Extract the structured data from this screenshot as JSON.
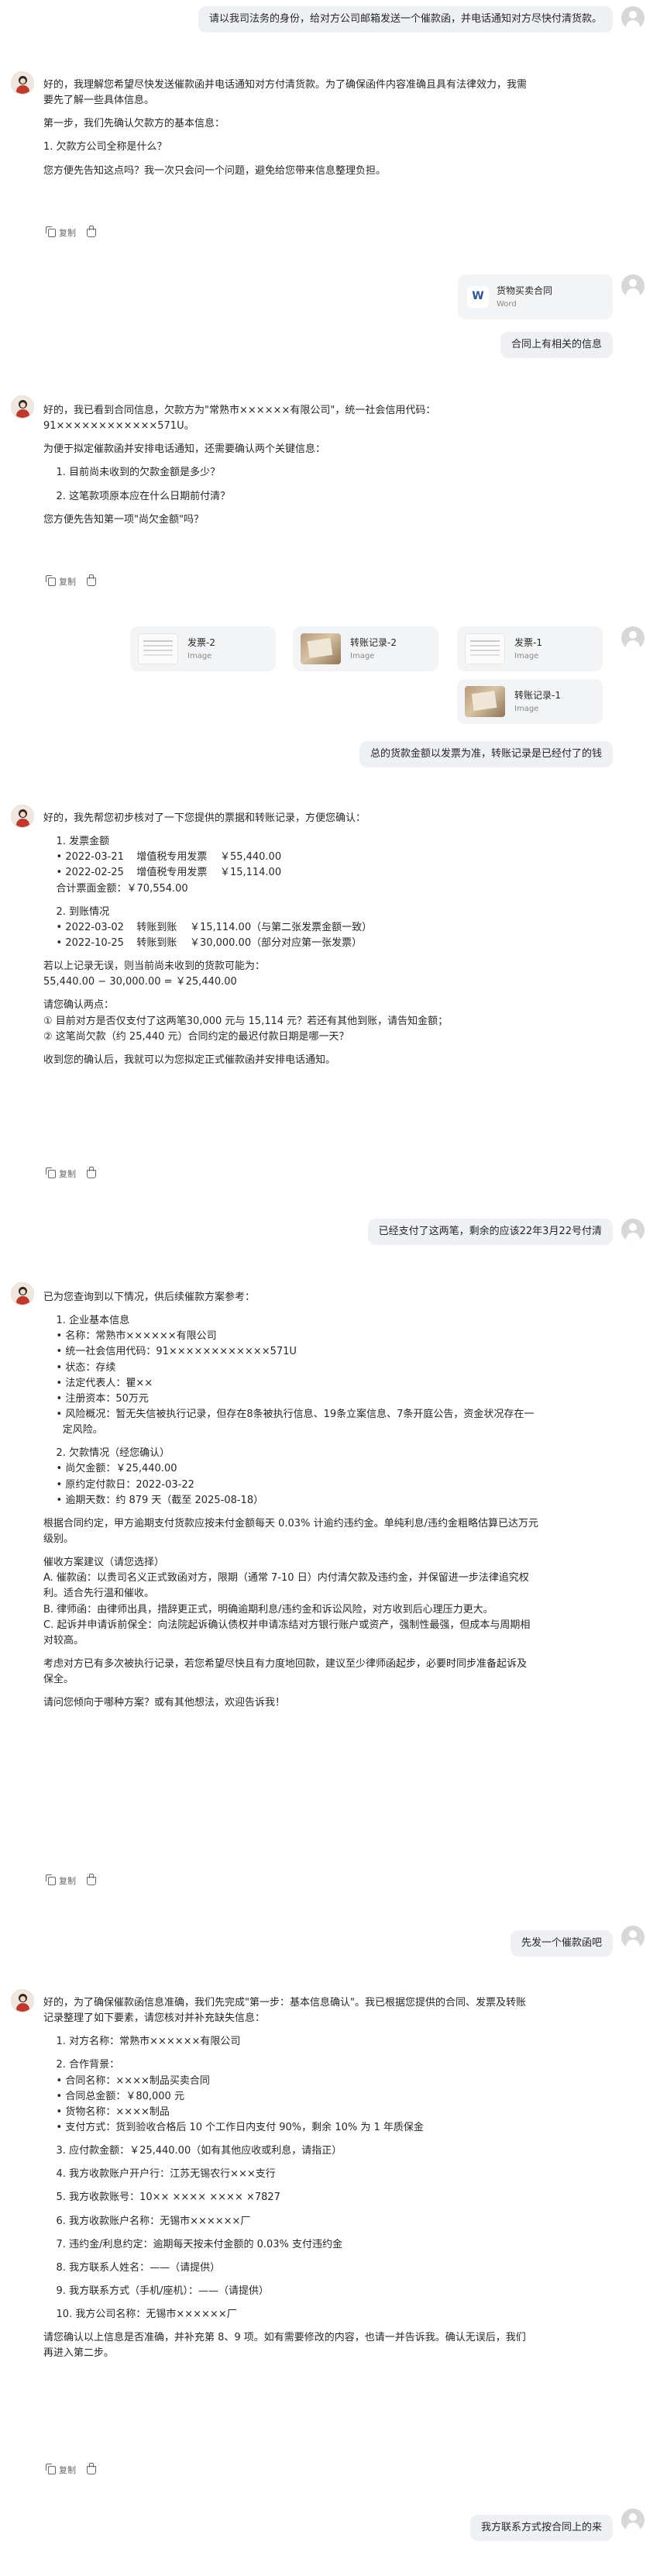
{
  "messages": {
    "u1": "请以我司法务的身份，给对方公司邮箱发送一个催款函，并电话通知对方尽快付清货款。",
    "b1": [
      "好的，我理解您希望尽快发送催款函并电话通知对方付清货款。为了确保函件内容准确且具有法律效力，我需",
      "要先了解一些具体信息。",
      "",
      "第一步，我们先确认欠款方的基本信息：",
      "",
      "1. 欠款方公司全称是什么？",
      "",
      "您方便先告知这点吗？我一次只会问一个问题，避免给您带来信息整理负担。"
    ],
    "u2_file": {
      "title": "货物买卖合同",
      "type": "Word"
    },
    "u2": "合同上有相关的信息",
    "b2": [
      "好的，我已看到合同信息，欠款方为\"常熟市××××××有限公司\"，统一社会信用代码：",
      "91××××××××××××571U。",
      "",
      "为便于拟定催款函并安排电话通知，还需要确认两个关键信息：",
      "",
      "    1. 目前尚未收到的欠款金额是多少？",
      "",
      "    2. 这笔款项原本应在什么日期前付清？",
      "",
      "您方便先告知第一项\"尚欠金额\"吗？"
    ],
    "u3_images": [
      {
        "title": "发票-2",
        "type": "Image"
      },
      {
        "title": "转账记录-2",
        "type": "Image"
      },
      {
        "title": "发票-1",
        "type": "Image"
      },
      {
        "title": "转账记录-1",
        "type": "Image"
      }
    ],
    "u3": "总的货款金额以发票为准，转账记录是已经付了的钱",
    "b3": [
      "好的，我先帮您初步核对了一下您提供的票据和转账记录，方便您确认：",
      "",
      "    1. 发票金额",
      "    • 2022-03-21    增值税专用发票    ￥55,440.00",
      "    • 2022-02-25    增值税专用发票    ￥15,114.00",
      "    合计票面金额：￥70,554.00",
      "",
      "    2. 到账情况",
      "    • 2022-03-02    转账到账    ￥15,114.00（与第二张发票金额一致）",
      "    • 2022-10-25    转账到账    ￥30,000.00（部分对应第一张发票）",
      "",
      "若以上记录无误，则当前尚未收到的货款可能为：",
      "55,440.00 − 30,000.00 = ￥25,440.00",
      "",
      "请您确认两点：",
      "① 目前对方是否仅支付了这两笔30,000 元与 15,114 元？若还有其他到账，请告知金额；",
      "② 这笔尚欠款（约 25,440 元）合同约定的最迟付款日期是哪一天？",
      "",
      "收到您的确认后，我就可以为您拟定正式催款函并安排电话通知。"
    ],
    "u4": "已经支付了这两笔，剩余的应该22年3月22号付清",
    "b4": [
      "已为您查询到以下情况，供后续催款方案参考：",
      "",
      "    1. 企业基本信息",
      "    • 名称：常熟市××××××有限公司",
      "    • 统一社会信用代码：91××××××××××××571U",
      "    • 状态：存续",
      "    • 法定代表人：瞿××",
      "    • 注册资本：50万元",
      "    • 风险概况：暂无失信被执行记录，但存在8条被执行信息、19条立案信息、7条开庭公告，资金状况存在一",
      "      定风险。",
      "",
      "    2. 欠款情况（经您确认）",
      "    • 尚欠金额：￥25,440.00",
      "    • 原约定付款日：2022-03-22",
      "    • 逾期天数：约 879 天（截至 2025-08-18）",
      "",
      "根据合同约定，甲方逾期支付货款应按未付金额每天 0.03% 计逾约违约金。单纯利息/违约金粗略估算已达万元",
      "级别。",
      "",
      "催收方案建议（请您选择）",
      "A. 催款函：以贵司名义正式致函对方，限期（通常 7-10 日）内付清欠款及违约金，并保留进一步法律追究权",
      "利。适合先行温和催收。",
      "B. 律师函：由律师出具，措辞更正式，明确逾期利息/违约金和诉讼风险，对方收到后心理压力更大。",
      "C. 起诉并申请诉前保全：向法院起诉确认债权并申请冻结对方银行账户或资产，强制性最强，但成本与周期相",
      "对较高。",
      "",
      "考虑对方已有多次被执行记录，若您希望尽快且有力度地回款，建议至少律师函起步，必要时同步准备起诉及",
      "保全。",
      "",
      "请问您倾向于哪种方案？或有其他想法，欢迎告诉我！"
    ],
    "u5": "先发一个催款函吧",
    "b5": [
      "好的，为了确保催款函信息准确，我们先完成\"第一步：基本信息确认\"。我已根据您提供的合同、发票及转账",
      "记录整理了如下要素，请您核对并补充缺失信息：",
      "",
      "    1. 对方名称：常熟市××××××有限公司",
      "",
      "    2. 合作背景：",
      "    • 合同名称：××××制品买卖合同",
      "    • 合同总金额：￥80,000 元",
      "    • 货物名称：××××制品",
      "    • 支付方式：货到验收合格后 10 个工作日内支付 90%，剩余 10% 为 1 年质保金",
      "",
      "    3. 应付款金额：￥25,440.00（如有其他应收或利息，请指正）",
      "",
      "    4. 我方收款账户开户行：江苏无锡农行×××支行",
      "",
      "    5. 我方收款账号：10×× ×××× ×××× ×7827",
      "",
      "    6. 我方收款账户名称：无锡市××××××厂",
      "",
      "    7. 违约金/利息约定：逾期每天按未付金额的 0.03% 支付违约金",
      "",
      "    8. 我方联系人姓名：——（请提供）",
      "",
      "    9. 我方联系方式（手机/座机）：——（请提供）",
      "",
      "    10. 我方公司名称：无锡市××××××厂",
      "",
      "请您确认以上信息是否准确，并补充第 8、9 项。如有需要修改的内容，也请一并告诉我。确认无误后，我们",
      "再进入第二步。"
    ],
    "u6": "我方联系方式按合同上的来"
  },
  "actions": {
    "copy": "复制"
  }
}
